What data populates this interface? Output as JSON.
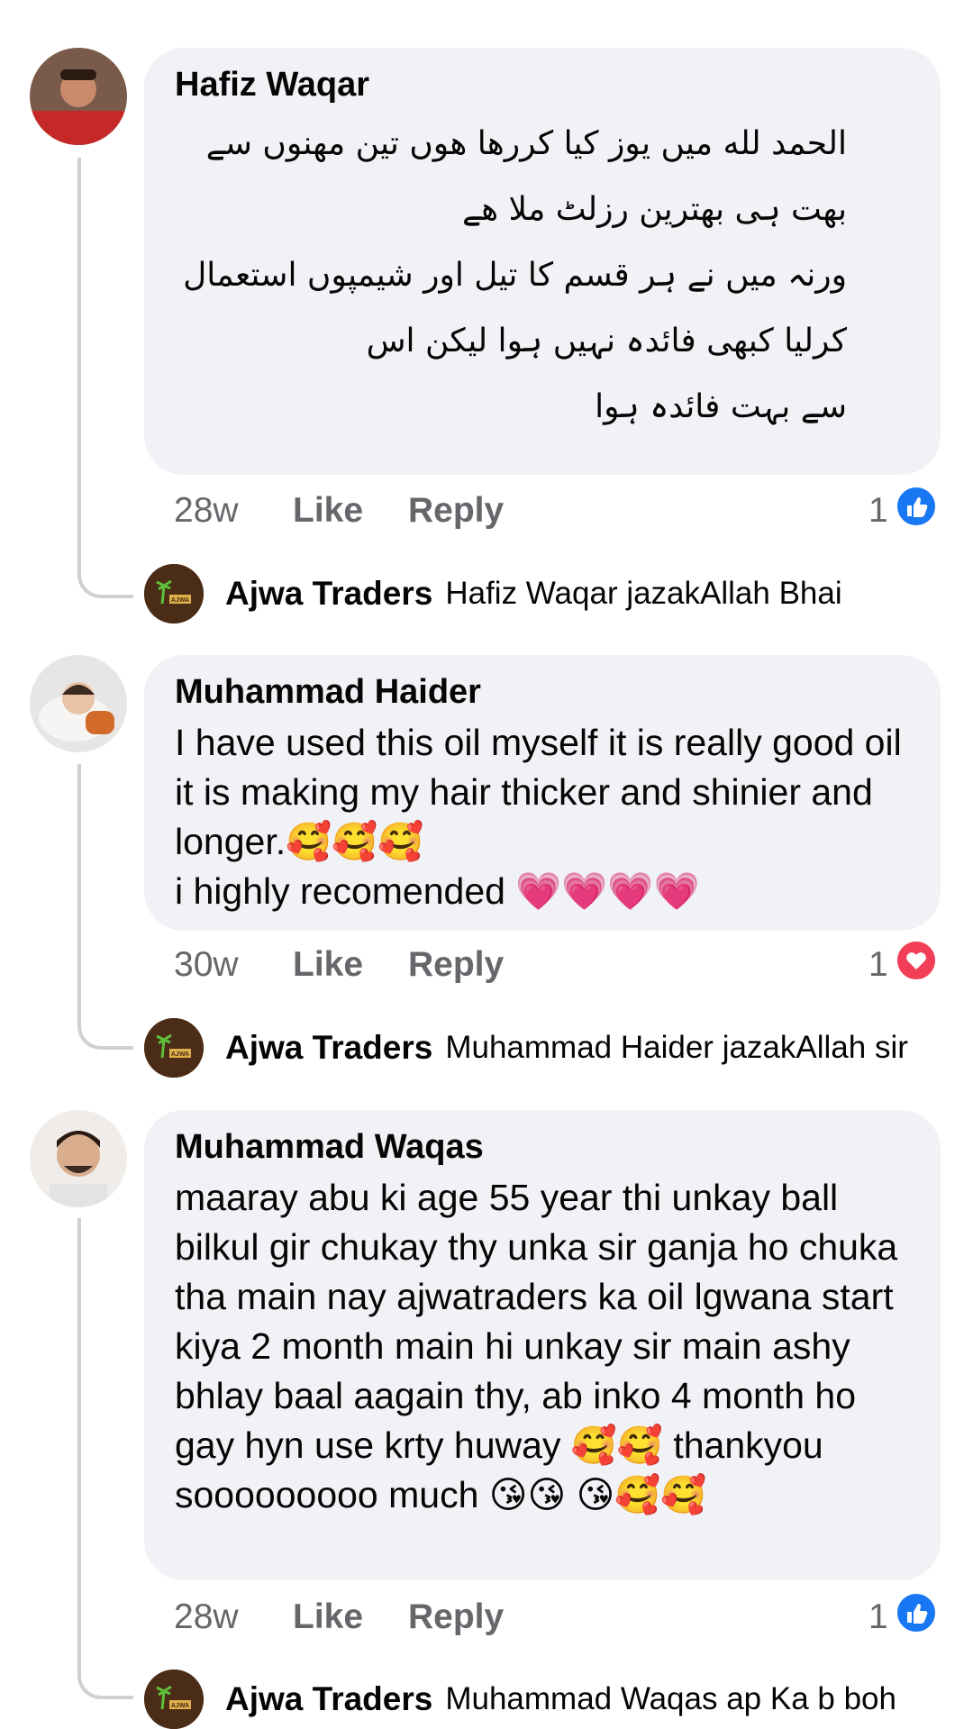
{
  "comments": [
    {
      "name": "Hafiz Waqar",
      "text": "الحمد لله میں یوز کیا  کررھا ھوں تین مھنوں سے\nبھت ہی بھترین رزلٹ ملا ھے\nورنہ میں نے ہر قسم کا تیل اور شیمپوں استعمال\nکرلیا کبھی فائدہ نہیں ہوا لیکن اس\nسے بہت فائدہ ہوا",
      "time": "28w",
      "like": "Like",
      "reply": "Reply",
      "reaction_count": "1",
      "reaction_icon": "like-icon",
      "reaction_color": "#1877f2",
      "reply_author": "Ajwa Traders",
      "reply_text": "Hafiz Waqar jazakAllah Bhai"
    },
    {
      "name": "Muhammad Haider",
      "text": "I have used this oil myself it is really good oil it is making my hair thicker and shinier and longer.🥰🥰🥰\ni highly recomended 💗💗💗💗",
      "time": "30w",
      "like": "Like",
      "reply": "Reply",
      "reaction_count": "1",
      "reaction_icon": "love-icon",
      "reaction_color": "#f33e58",
      "reply_author": "Ajwa Traders",
      "reply_text": "Muhammad Haider jazakAllah sir"
    },
    {
      "name": "Muhammad Waqas",
      "text": "maaray abu ki age 55 year thi unkay ball bilkul gir chukay thy unka sir ganja ho chuka tha main nay ajwatraders ka oil lgwana start kiya 2 month main hi unkay sir main ashy bhlay baal aagain thy, ab inko 4 month ho gay hyn use krty huway 🥰🥰 thankyou sooooooooo much  😘😘 😘🥰🥰",
      "time": "28w",
      "like": "Like",
      "reply": "Reply",
      "reaction_count": "1",
      "reaction_icon": "like-icon",
      "reaction_color": "#1877f2",
      "reply_author": "Ajwa Traders",
      "reply_text": "Muhammad Waqas ap Ka b boh"
    }
  ],
  "page_logo_text": "AJWA"
}
